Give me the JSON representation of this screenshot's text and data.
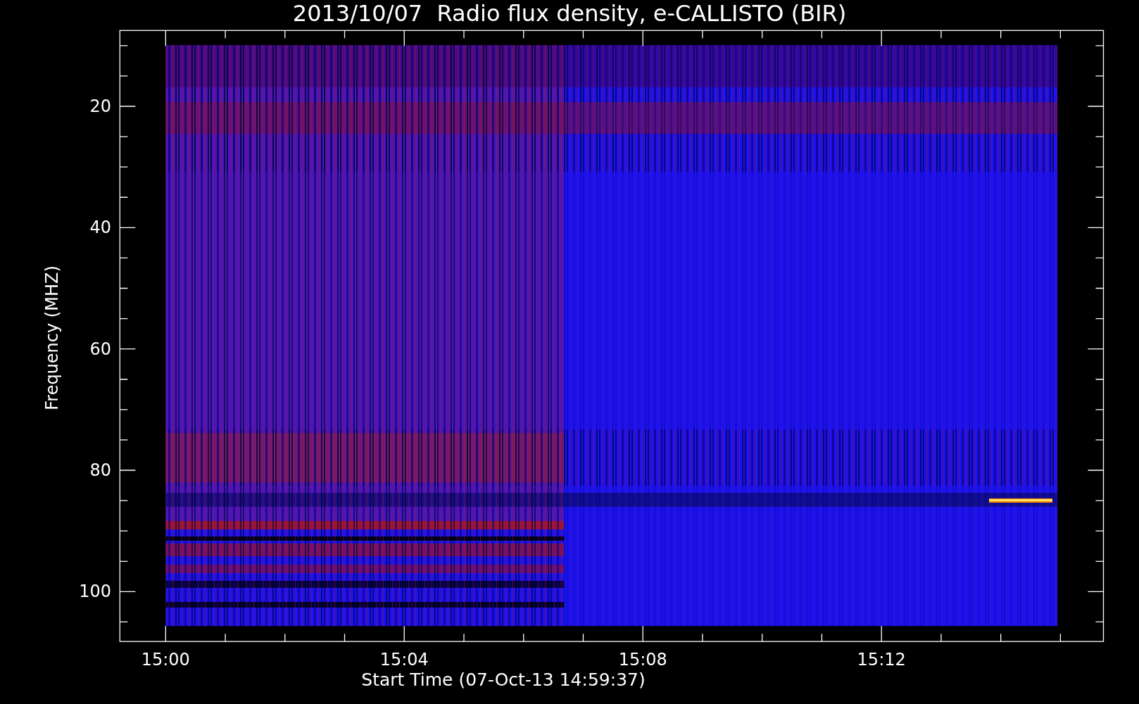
{
  "title": "2013/10/07  Radio flux density, e-CALLISTO (BIR)",
  "y_axis": {
    "label": "Frequency (MHZ)",
    "ticks": [
      "20",
      "40",
      "60",
      "80",
      "100"
    ]
  },
  "x_axis": {
    "label": "Start Time (07-Oct-13 14:59:37)",
    "ticks": [
      "15:00",
      "15:04",
      "15:08",
      "15:12"
    ]
  }
}
